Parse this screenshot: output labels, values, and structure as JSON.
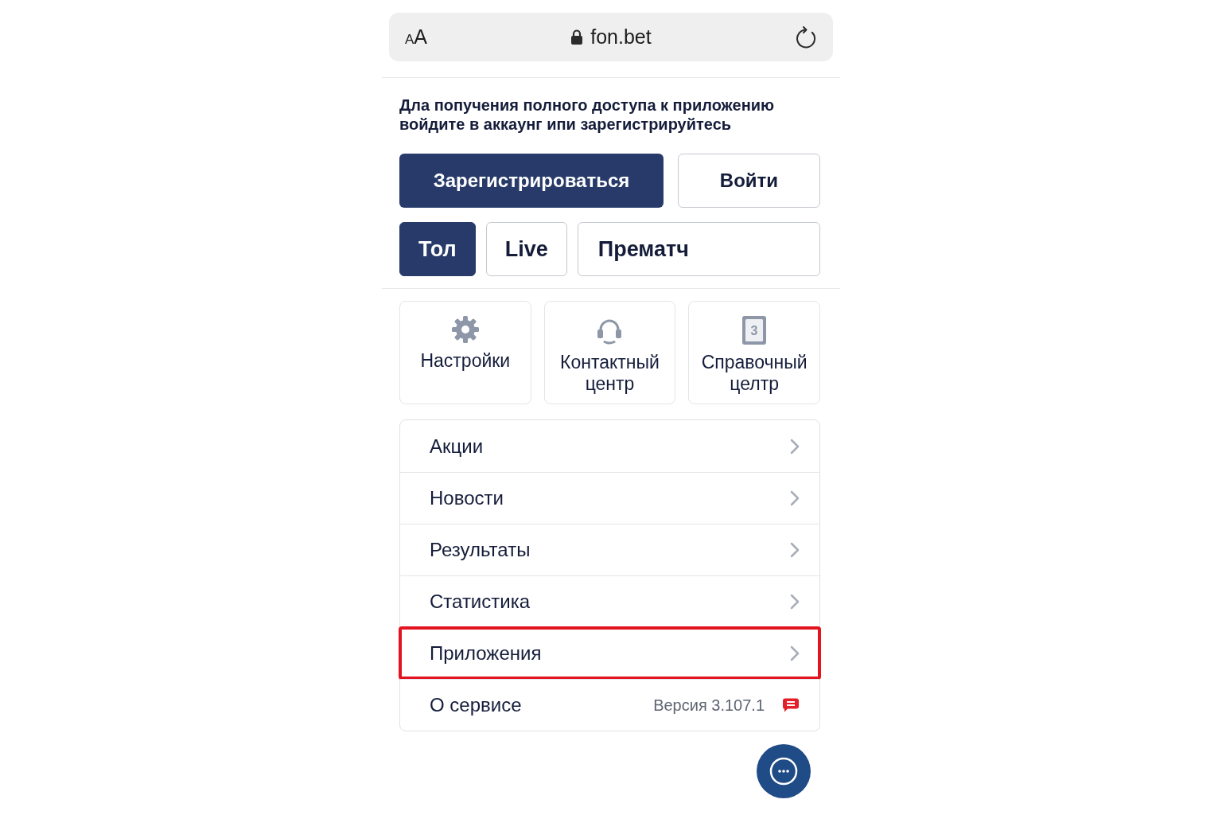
{
  "address_bar": {
    "text_size_button": {
      "small": "A",
      "large": "A"
    },
    "secure": true,
    "url": "fon.bet"
  },
  "notice": "Дла попучения полного доступа к приложению войдите в аккаунг ипи зарегистрируйтесь",
  "auth_buttons": [
    {
      "kind": "primary",
      "label": "Зарегистрироваться"
    },
    {
      "kind": "secondary",
      "label": "Войти"
    }
  ],
  "tabs": [
    {
      "label": "Тол",
      "selected": true
    },
    {
      "label": "Live",
      "selected": false
    },
    {
      "label": "Прематч",
      "selected": false
    }
  ],
  "shortcuts": [
    {
      "kind": "settings",
      "label": "Настройки"
    },
    {
      "kind": "support",
      "label": "Контактный центр"
    },
    {
      "kind": "help",
      "label": "Справочный целтр",
      "icon_text": "3"
    }
  ],
  "menu": [
    {
      "kind": "link",
      "label": "Акции",
      "highlighted": false
    },
    {
      "kind": "link",
      "label": "Новости",
      "highlighted": false
    },
    {
      "kind": "link",
      "label": "Результаты",
      "highlighted": false
    },
    {
      "kind": "link",
      "label": "Статистика",
      "highlighted": false
    },
    {
      "kind": "link",
      "label": "Приложения",
      "highlighted": true
    },
    {
      "kind": "info",
      "label": "О сервисе",
      "version": "Версия 3.107.1",
      "highlighted": false
    }
  ]
}
